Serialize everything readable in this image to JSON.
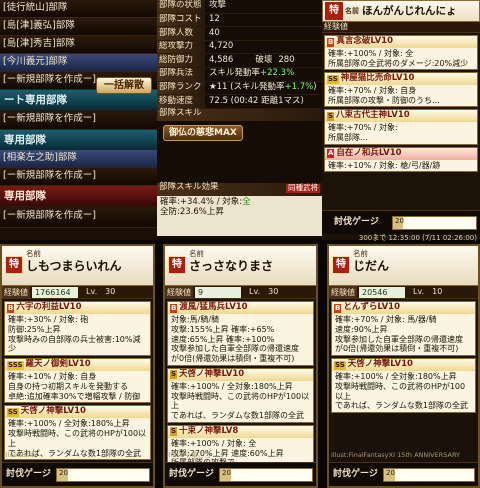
{
  "left_list": {
    "rows": [
      {
        "text": "[徒行統山]部隊",
        "style": "dark"
      },
      {
        "text": "[島[津]義弘]部隊",
        "style": "dark"
      },
      {
        "text": "[島[津]秀吉]部隊",
        "style": "dark"
      },
      {
        "text": "[今川義元]部隊",
        "style": "blue"
      },
      {
        "text": "[ー新規部隊を作成ー]",
        "style": "dark"
      }
    ],
    "heading1": "ート専用部隊",
    "disband_button": "一括解散",
    "rows2": [
      {
        "text": "[ー新規部隊を作成ー]",
        "style": "dark"
      }
    ],
    "heading2": "専用部隊",
    "rows3": [
      {
        "text": "[相楽左之助]部隊",
        "style": "blue"
      },
      {
        "text": "[ー新規部隊を作成ー]",
        "style": "dark"
      }
    ],
    "heading3": "専用部隊",
    "rows4": [
      {
        "text": "[ー新規部隊を作成ー]",
        "style": "dark"
      }
    ]
  },
  "status": {
    "rows": [
      {
        "label": "部隊の状態",
        "value": "攻撃"
      },
      {
        "label": "部隊コスト",
        "value": "12"
      },
      {
        "label": "部隊人数",
        "value": "40"
      },
      {
        "label": "総攻撃力",
        "value": "4,720"
      },
      {
        "label": "総防御力",
        "value": "4,586",
        "extra_label": "破壊",
        "extra_value": "280"
      },
      {
        "label": "部隊兵法",
        "value": "スキル発動率",
        "value_green": "+22.3%"
      },
      {
        "label": "部隊ランク",
        "value": "★11 (スキル発動率",
        "value_green": "+1.7%",
        "value_tail": ")"
      },
      {
        "label": "移動速度",
        "value": "72.5 (00:42 距離1マス)"
      }
    ],
    "skill_header": "部隊スキル",
    "skill_name": "御仏の慈悲MAX",
    "effect_header": "部隊スキル効果",
    "effect_tag": "同種武将",
    "effect_line1_a": "確率:+34.4% / 対象:",
    "effect_line1_b": "全",
    "effect_line2": "全防:23.6%上昇"
  },
  "top_right": {
    "name_label": "名前",
    "name": "ほんがんじれんにょ",
    "exp_label": "経験値",
    "skills": [
      {
        "badge": "B",
        "badge_class": "bB",
        "title": "真言念破LV10",
        "body": "確率:+100% / 対象: 全\n所属部隊の全武将のダメージ:20%減少"
      },
      {
        "badge": "SS",
        "badge_class": "bSS",
        "title": "神屋猫比売命LV10",
        "body": "確率:+70% / 対象: 自身\n所属部隊の攻撃・防御のうち..."
      },
      {
        "badge": "S",
        "badge_class": "bS",
        "title": "八束古代主神LV10",
        "body": "確率:+70% / 対象:\n所属部隊..."
      },
      {
        "badge": "A",
        "badge_class": "bA",
        "title": "自在ノ和兵LV10",
        "body": "確率:+10% / 対象: 槍/弓/器/跡"
      }
    ],
    "tobatsu_label": "討伐ゲージ",
    "tobatsu_value": "20",
    "tobatsu_fraction": 0.12,
    "timestamp": "300まで 12:35:00 (7/11 02:26:00)"
  },
  "cards": [
    {
      "kanji": "特",
      "name_label": "名前",
      "name": "しもつまらいれん",
      "exp_label": "経験値",
      "exp_value": "1766164",
      "lv_label": "Lv.",
      "lv_value": "30",
      "skills": [
        {
          "badge": "B",
          "badge_class": "bB",
          "title": "六字の利益LV10",
          "body": "確率:+30% / 対象: 砲\n防御:25%上昇\n攻撃時みの自部隊の兵士被害:10%減少"
        },
        {
          "badge": "SSS",
          "badge_class": "bSSS",
          "title": "羅天ノ御剣LV10",
          "body": "確率:+10% / 対象: 自身\n自身の持つ初期スキルを発動する\n卓絶:追加確率30%で増幅攻撃 / 防御"
        },
        {
          "badge": "SS",
          "badge_class": "bSS",
          "title": "天啓ノ神撃LV10",
          "body": "確率:+100% / 全対象:180%上昇\n攻撃時戦闘時、この武将のHPが100以上\nであれば、ランダムな数1部隊の全武"
        }
      ],
      "illus": "illust:Bsa2",
      "tobatsu_label": "討伐ゲージ",
      "tobatsu_value": "20",
      "tobatsu_fraction": 0.12
    },
    {
      "kanji": "特",
      "name_label": "名前",
      "name": "さっさなりまさ",
      "exp_label": "経験値",
      "exp_value": "9",
      "lv_label": "Lv.",
      "lv_value": "30",
      "skills": [
        {
          "badge": "B",
          "badge_class": "bB",
          "title": "渡風/猛馬兵LV10",
          "body": "対象:馬/騎/騎\n攻撃:155%上昇 確率:+65%\n速度:65%上昇 確率:+100%\n攻撃参加した自軍全部隊の帰還速度\nが0倍(帰還効果は積倒・重複不可)"
        },
        {
          "badge": "S",
          "badge_class": "bS",
          "title": "天啓ノ神撃LV10",
          "body": "確率:+100% / 全対象:180%上昇\n攻撃時戦闘時、この武将のHPが100以上\nであれば、ランダムな数1部隊の全武"
        },
        {
          "badge": "S",
          "badge_class": "bS",
          "title": "十束ノ神撃LV8",
          "body": "確率:+100% / 対象: 全\n攻撃:270%上昇 速度:60%上昇\n所属部隊の攻撃で..."
        }
      ],
      "illus": "illust:小竜こゴ",
      "tobatsu_label": "討伐ゲージ",
      "tobatsu_value": "20",
      "tobatsu_fraction": 0.12
    },
    {
      "kanji": "特",
      "name_label": "名前",
      "name": "じだん",
      "exp_label": "経験値",
      "exp_value": "20546",
      "lv_label": "Lv.",
      "lv_value": "10",
      "skills": [
        {
          "badge": "B",
          "badge_class": "bB",
          "title": "とんずらLV10",
          "body": "確率:+70% / 対象: 馬/器/騎\n速度:90%上昇\n攻撃参加した自軍全部隊の帰還速度\nが0倍(帰還効果は積倒・重複不可)"
        },
        {
          "badge": "SS",
          "badge_class": "bSS",
          "title": "天啓ノ神撃LV10",
          "body": "確率:+100% / 全対象:180%上昇\n攻撃時戦闘時、この武将のHPが100以上\nであれば、ランダムな数1部隊の全武"
        }
      ],
      "illus": "illust:FinalFantasyXI 15th ANNIVERSARY",
      "tobatsu_label": "討伐ゲージ",
      "tobatsu_value": "20",
      "tobatsu_fraction": 0.12
    }
  ]
}
